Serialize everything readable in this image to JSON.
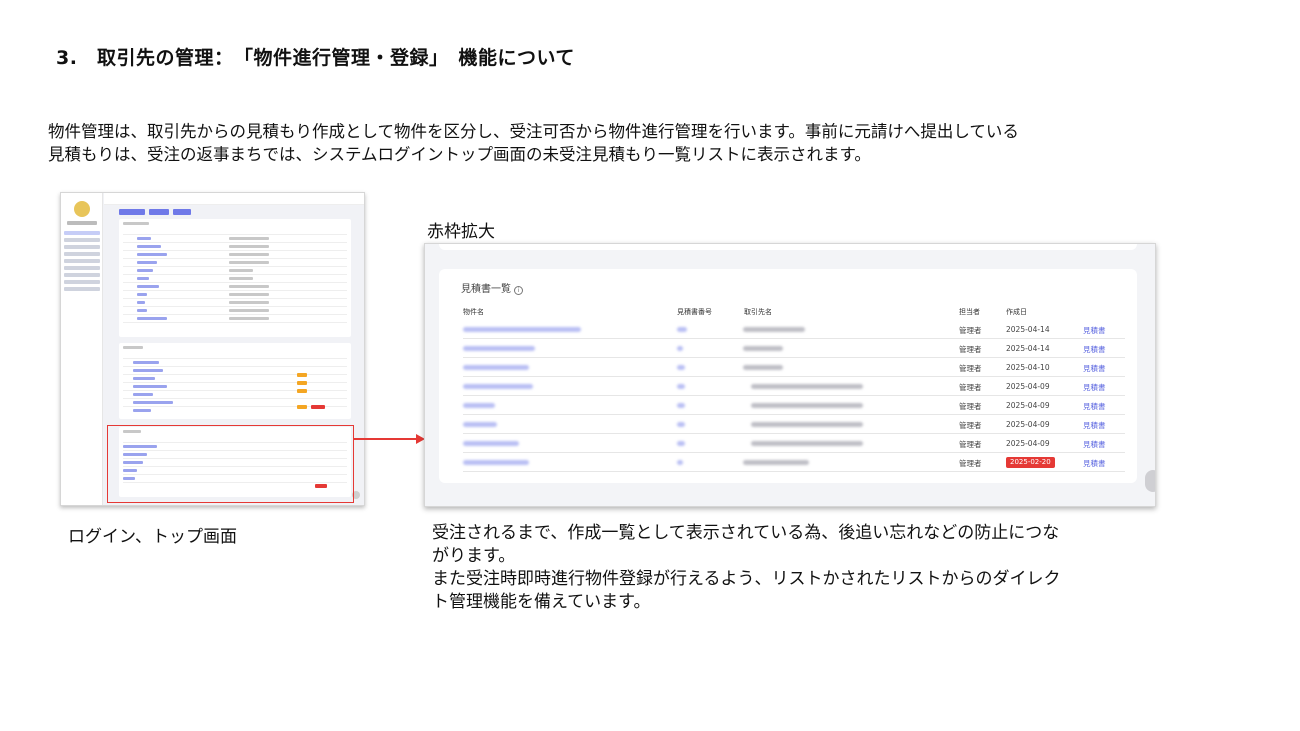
{
  "page": {
    "title": "3.　取引先の管理：　「物件進行管理・登録」　機能について",
    "intro_lines": [
      "物件管理は、取引先からの見積もり作成として物件を区分し、受注可否から物件進行管理を行います。事前に元請けへ提出している",
      "見積もりは、受注の返事まちでは、システムログイントップ画面の未受注見積もり一覧リストに表示されます。"
    ],
    "left_caption": "ログイン、トップ画面",
    "zoom_label": "赤枠拡大",
    "right_caption_lines": [
      "受注されるまで、作成一覧として表示されている為、後追い忘れなどの防止につな",
      "がります。",
      "また受注時即時進行物件登録が行えるよう、リストかされたリストからのダイレク",
      "ト管理機能を備えています。"
    ]
  },
  "colors": {
    "accent": "#5b66e0",
    "highlight_frame": "#e53935",
    "badge_red": "#e53935",
    "badge_orange": "#f4a623"
  },
  "zoom_table": {
    "title": "見積書一覧",
    "info_icon": "info-circle-icon",
    "columns": [
      "物件名",
      "見積書番号",
      "取引先名",
      "担当者",
      "作成日"
    ],
    "rows": [
      {
        "person": "管理者",
        "date": "2025-04-14",
        "badge": false,
        "action": "見積書"
      },
      {
        "person": "管理者",
        "date": "2025-04-14",
        "badge": false,
        "action": "見積書"
      },
      {
        "person": "管理者",
        "date": "2025-04-10",
        "badge": false,
        "action": "見積書"
      },
      {
        "person": "管理者",
        "date": "2025-04-09",
        "badge": false,
        "action": "見積書"
      },
      {
        "person": "管理者",
        "date": "2025-04-09",
        "badge": false,
        "action": "見積書"
      },
      {
        "person": "管理者",
        "date": "2025-04-09",
        "badge": false,
        "action": "見積書"
      },
      {
        "person": "管理者",
        "date": "2025-04-09",
        "badge": false,
        "action": "見積書"
      },
      {
        "person": "管理者",
        "date": "2025-02-20",
        "badge": true,
        "action": "見積書"
      }
    ]
  }
}
